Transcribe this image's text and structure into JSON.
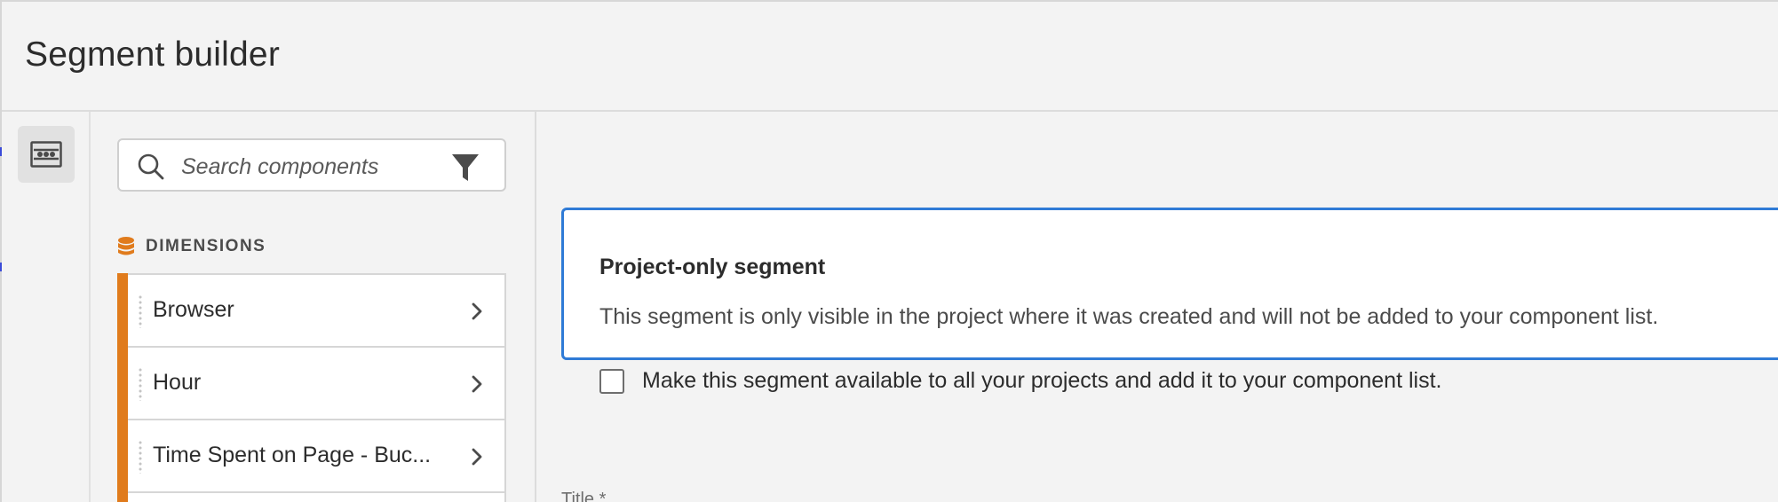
{
  "header": {
    "title": "Segment builder"
  },
  "panel": {
    "search": {
      "placeholder": "Search components",
      "value": ""
    },
    "section": {
      "label": "DIMENSIONS",
      "accent_color": "#e07b1c"
    },
    "items": [
      {
        "label": "Browser"
      },
      {
        "label": "Hour"
      },
      {
        "label": "Time Spent on Page - Buc..."
      }
    ]
  },
  "notice": {
    "title": "Project-only segment",
    "body": "This segment is only visible in the project where it was created and will not be added to your component list.",
    "checkbox_label": "Make this segment available to all your projects and add it to your component list.",
    "checked": false,
    "border_color": "#2f7bd6"
  },
  "form": {
    "title_label": "Title *"
  },
  "icons": {
    "rail": "segment-components-icon",
    "search": "search-icon",
    "filter": "filter-icon",
    "dimensions": "dimensions-icon",
    "chevron": "chevron-right-icon"
  }
}
